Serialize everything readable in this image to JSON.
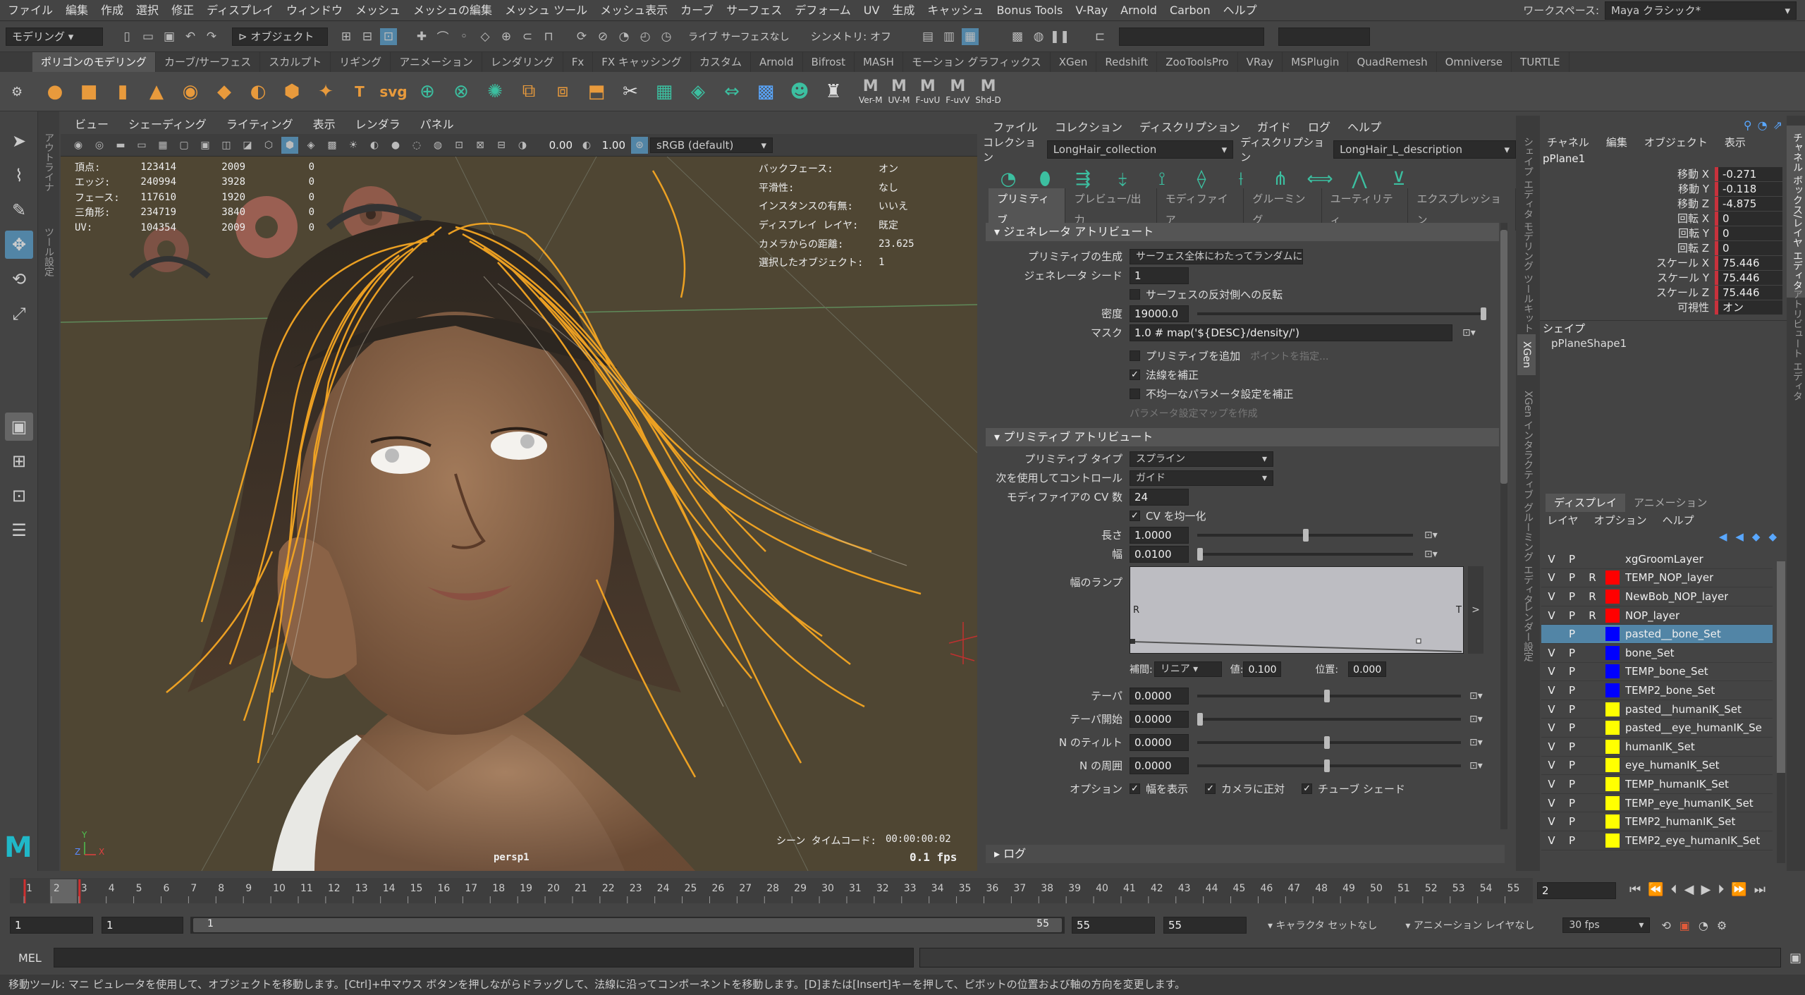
{
  "menu": [
    "ファイル",
    "編集",
    "作成",
    "選択",
    "修正",
    "ディスプレイ",
    "ウィンドウ",
    "メッシュ",
    "メッシュの編集",
    "メッシュ ツール",
    "メッシュ表示",
    "カーブ",
    "サーフェス",
    "デフォーム",
    "UV",
    "生成",
    "キャッシュ",
    "Bonus Tools",
    "V-Ray",
    "Arnold",
    "Carbon",
    "ヘルプ"
  ],
  "workspace": {
    "label": "ワークスペース:",
    "value": "Maya クラシック*"
  },
  "status": {
    "mode": "モデリング",
    "object": "オブジェクト",
    "live": "ライブ サーフェスなし",
    "symmetry": "シンメトリ: オフ"
  },
  "shelf_tabs": [
    "ポリゴンのモデリング",
    "カーブ/サーフェス",
    "スカルプト",
    "リギング",
    "アニメーション",
    "レンダリング",
    "Fx",
    "FX キャッシング",
    "カスタム",
    "Arnold",
    "Bifrost",
    "MASH",
    "モーション グラフィックス",
    "XGen",
    "Redshift",
    "ZooToolsPro",
    "VRay",
    "MSPlugin",
    "QuadRemesh",
    "Omniverse",
    "TURTLE"
  ],
  "shelf_icons": [
    {
      "name": "sphere-icon",
      "g": "●",
      "c": "o"
    },
    {
      "name": "cube-icon",
      "g": "■",
      "c": "o"
    },
    {
      "name": "cylinder-icon",
      "g": "▮",
      "c": "o"
    },
    {
      "name": "cone-icon",
      "g": "▲",
      "c": "o"
    },
    {
      "name": "torus-icon",
      "g": "◉",
      "c": "o"
    },
    {
      "name": "plane-icon",
      "g": "◆",
      "c": "o"
    },
    {
      "name": "disc-icon",
      "g": "◐",
      "c": "o"
    },
    {
      "name": "platonic-icon",
      "g": "⬢",
      "c": "o"
    },
    {
      "name": "superellipse-icon",
      "g": "✦",
      "c": "o"
    },
    {
      "name": "type-icon",
      "g": "T",
      "c": "o"
    },
    {
      "name": "svg-icon",
      "g": "svg",
      "c": "o"
    },
    {
      "name": "combine-icon",
      "g": "⊕",
      "c": "t"
    },
    {
      "name": "separate-icon",
      "g": "⊗",
      "c": "t"
    },
    {
      "name": "smooth-icon",
      "g": "✺",
      "c": "t"
    },
    {
      "name": "extrude-icon",
      "g": "⧉",
      "c": "o"
    },
    {
      "name": "bridge-icon",
      "g": "⧈",
      "c": "o"
    },
    {
      "name": "bevel-icon",
      "g": "⬒",
      "c": "o"
    },
    {
      "name": "multicut-icon",
      "g": "✂",
      "c": "w"
    },
    {
      "name": "uv-icon",
      "g": "▦",
      "c": "t"
    },
    {
      "name": "retopo-icon",
      "g": "◈",
      "c": "t"
    },
    {
      "name": "mirror-icon",
      "g": "⇔",
      "c": "t"
    },
    {
      "name": "grid-icon",
      "g": "▩",
      "c": "b"
    },
    {
      "name": "head-icon",
      "g": "☻",
      "c": "t"
    },
    {
      "name": "rig-icon",
      "g": "♜",
      "c": "w"
    }
  ],
  "shelf_text": [
    "Ver-M",
    "UV-M",
    "F-uvU",
    "F-uvV",
    "Shd-D"
  ],
  "side_labels": [
    "アウトライナ",
    "ツール設定"
  ],
  "viewport": {
    "menu": [
      "ビュー",
      "シェーディング",
      "ライティング",
      "表示",
      "レンダラ",
      "パネル"
    ],
    "exposure": "0.00",
    "gamma": "1.00",
    "colorspace": "sRGB (default)",
    "stats": [
      {
        "k": "頂点:",
        "a": "123414",
        "b": "2009",
        "c": "0"
      },
      {
        "k": "エッジ:",
        "a": "240994",
        "b": "3928",
        "c": "0"
      },
      {
        "k": "フェース:",
        "a": "117610",
        "b": "1920",
        "c": "0"
      },
      {
        "k": "三角形:",
        "a": "234719",
        "b": "3840",
        "c": "0"
      },
      {
        "k": "UV:",
        "a": "104354",
        "b": "2009",
        "c": "0"
      }
    ],
    "info": [
      {
        "k": "バックフェース:",
        "v": "オン"
      },
      {
        "k": "平滑性:",
        "v": "なし"
      },
      {
        "k": "インスタンスの有無:",
        "v": "いいえ"
      },
      {
        "k": "ディスプレイ レイヤ:",
        "v": "既定"
      },
      {
        "k": "カメラからの距離:",
        "v": "23.625"
      },
      {
        "k": "選択したオブジェクト:",
        "v": "1"
      }
    ],
    "camera": "persp1",
    "timecode_label": "シーン タイムコード:",
    "timecode": "00:00:00:02",
    "fps": "0.1 fps"
  },
  "xgen": {
    "menu": [
      "ファイル",
      "コレクション",
      "ディスクリプション",
      "ガイド",
      "ログ",
      "ヘルプ"
    ],
    "collection_label": "コレクション",
    "collection": "LongHair_collection",
    "description_label": "ディスクリプション",
    "description": "LongHair_L_description",
    "tabs": [
      "プリミティブ",
      "プレビュー/出力",
      "モディファイア",
      "グルーミング",
      "ユーティリティ",
      "エクスプレッション"
    ],
    "gen_section": "ジェネレータ アトリビュート",
    "gen_label": "プリミティブの生成",
    "gen_value": "サーフェス全体にわたってランダムに",
    "seed_label": "ジェネレータ シード",
    "seed": "1",
    "flip_label": "サーフェスの反対側への反転",
    "density_label": "密度",
    "density": "19000.0",
    "mask_label": "マスク",
    "mask": "1.0 # map('${DESC}/density/')",
    "add_label": "プリミティブを追加",
    "point_label": "ポイントを指定...",
    "normal_label": "法線を補正",
    "param_label": "不均一なパラメータ設定を補正",
    "param_map": "パラメータ設定マップを作成",
    "prim_section": "プリミティブ アトリビュート",
    "type_label": "プリミティブ タイプ",
    "type_value": "スプライン",
    "control_label": "次を使用してコントロール",
    "control_value": "ガイド",
    "cv_label": "モディファイアの CV 数",
    "cv": "24",
    "cv_even": "CV を均一化",
    "length_label": "長さ",
    "length": "1.0000",
    "width_label": "幅",
    "width": "0.0100",
    "ramp_label": "幅のランプ",
    "ramp_r": "R",
    "ramp_t": "T",
    "ramp_more": ">",
    "interp_label": "補間:",
    "interp": "リニア",
    "val_label": "値:",
    "val": "0.100",
    "pos_label": "位置:",
    "pos": "0.000",
    "taper_label": "テーパ",
    "taper": "0.0000",
    "taper_start_label": "テーパ開始",
    "taper_start": "0.0000",
    "ntilt_label": "N のティルト",
    "ntilt": "0.0000",
    "ntwist_label": "N の周囲",
    "ntwist": "0.0000",
    "option_label": "オプション",
    "opt1": "幅を表示",
    "opt2": "カメラに正対",
    "opt3": "チューブ シェード",
    "log": "ログ"
  },
  "vtabs": [
    "シェイプ エディタ",
    "モデリング ツールキット",
    "XGen",
    "XGen インタラクティブ グルーミング エディタ",
    "レンダー設定"
  ],
  "channel": {
    "menu": [
      "チャネル",
      "編集",
      "オブジェクト",
      "表示"
    ],
    "object": "pPlane1",
    "rows": [
      {
        "n": "移動 X",
        "v": "-0.271"
      },
      {
        "n": "移動 Y",
        "v": "-0.118"
      },
      {
        "n": "移動 Z",
        "v": "-4.875"
      },
      {
        "n": "回転 X",
        "v": "0"
      },
      {
        "n": "回転 Y",
        "v": "0"
      },
      {
        "n": "回転 Z",
        "v": "0"
      },
      {
        "n": "スケール X",
        "v": "75.446"
      },
      {
        "n": "スケール Y",
        "v": "75.446"
      },
      {
        "n": "スケール Z",
        "v": "75.446"
      },
      {
        "n": "可視性",
        "v": "オン"
      }
    ],
    "shape_label": "シェイプ",
    "shape": "pPlaneShape1"
  },
  "layers": {
    "tabs": [
      "ディスプレイ",
      "アニメーション"
    ],
    "menu": [
      "レイヤ",
      "オプション",
      "ヘルプ"
    ],
    "rows": [
      {
        "v": "V",
        "p": "P",
        "r": "",
        "color": "#444444",
        "name": "xgGroomLayer",
        "sel": false
      },
      {
        "v": "V",
        "p": "P",
        "r": "R",
        "color": "#ff0000",
        "name": "TEMP_NOP_layer",
        "sel": false
      },
      {
        "v": "V",
        "p": "P",
        "r": "R",
        "color": "#ff0000",
        "name": "NewBob_NOP_layer",
        "sel": false
      },
      {
        "v": "V",
        "p": "P",
        "r": "R",
        "color": "#ff0000",
        "name": "NOP_layer",
        "sel": false
      },
      {
        "v": "",
        "p": "P",
        "r": "",
        "color": "#0000ff",
        "name": "pasted__bone_Set",
        "sel": true
      },
      {
        "v": "V",
        "p": "P",
        "r": "",
        "color": "#0000ff",
        "name": "bone_Set",
        "sel": false
      },
      {
        "v": "V",
        "p": "P",
        "r": "",
        "color": "#0000ff",
        "name": "TEMP_bone_Set",
        "sel": false
      },
      {
        "v": "V",
        "p": "P",
        "r": "",
        "color": "#0000ff",
        "name": "TEMP2_bone_Set",
        "sel": false
      },
      {
        "v": "V",
        "p": "P",
        "r": "",
        "color": "#ffff00",
        "name": "pasted__humanIK_Set",
        "sel": false
      },
      {
        "v": "V",
        "p": "P",
        "r": "",
        "color": "#ffff00",
        "name": "pasted__eye_humanIK_Se",
        "sel": false
      },
      {
        "v": "V",
        "p": "P",
        "r": "",
        "color": "#ffff00",
        "name": "humanIK_Set",
        "sel": false
      },
      {
        "v": "V",
        "p": "P",
        "r": "",
        "color": "#ffff00",
        "name": "eye_humanIK_Set",
        "sel": false
      },
      {
        "v": "V",
        "p": "P",
        "r": "",
        "color": "#ffff00",
        "name": "TEMP_humanIK_Set",
        "sel": false
      },
      {
        "v": "V",
        "p": "P",
        "r": "",
        "color": "#ffff00",
        "name": "TEMP_eye_humanIK_Set",
        "sel": false
      },
      {
        "v": "V",
        "p": "P",
        "r": "",
        "color": "#ffff00",
        "name": "TEMP2_humanIK_Set",
        "sel": false
      },
      {
        "v": "V",
        "p": "P",
        "r": "",
        "color": "#ffff00",
        "name": "TEMP2_eye_humanIK_Set",
        "sel": false
      }
    ]
  },
  "right_tabs": [
    "チャネル ボックス/レイヤ エディタ",
    "アトリビュート エディタ"
  ],
  "timeline": {
    "start": 1,
    "end": 55,
    "current": "2",
    "marker1": 1,
    "marker2": 3
  },
  "range": {
    "start": "1",
    "start2": "1",
    "slider_start": "1",
    "slider_end": "55",
    "end": "55",
    "end2": "55",
    "char_set": "キャラクタ セットなし",
    "anim_layer": "アニメーション レイヤなし",
    "fps": "30 fps"
  },
  "cmd": {
    "label": "MEL"
  },
  "help": "移動ツール: マニ ピュレータを使用して、オブジェクトを移動します。[Ctrl]+中マウス ボタンを押しながらドラッグして、法線に沿ってコンポーネントを移動します。[D]または[Insert]キーを押して、ピボットの位置および軸の方向を変更します。"
}
